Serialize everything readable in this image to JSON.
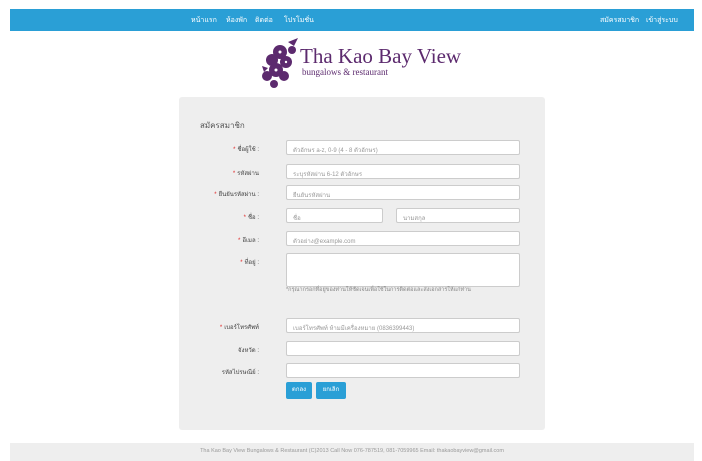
{
  "nav": {
    "left_items": [
      {
        "label": "หน้าแรก"
      },
      {
        "label": "ห้องพัก"
      },
      {
        "label": "ติดต่อ"
      },
      {
        "label": "โปรโมชั่น"
      }
    ],
    "right_items": [
      {
        "label": "สมัครสมาชิก"
      },
      {
        "label": "เข้าสู่ระบบ"
      }
    ]
  },
  "logo": {
    "title": "Tha Kao Bay View",
    "subtitle": "bungalows & restaurant"
  },
  "form": {
    "title": "สมัครสมาชิก",
    "fields": {
      "username": {
        "label": "ชื่อผู้ใช้ :",
        "placeholder": "ตัวอักษร a-z, 0-9 (4 - 8 ตัวอักษร)"
      },
      "password": {
        "label": "รหัสผ่าน",
        "placeholder": "ระบุรหัสผ่าน 6-12 ตัวอักษร"
      },
      "confirm_password": {
        "label": "ยืนยันรหัสผ่าน :",
        "placeholder": "ยืนยันรหัสผ่าน"
      },
      "name": {
        "label": "ชื่อ :",
        "first_placeholder": "ชื่อ",
        "last_placeholder": "นามสกุล"
      },
      "email": {
        "label": "อีเมล :",
        "placeholder": "ตัวอย่าง@example.com"
      },
      "address": {
        "label": "ที่อยู่ :",
        "placeholder": ""
      },
      "address_help": "*กรุณากรอกที่อยู่ของท่านให้ชัดเจนเพื่อใช้ในการติดต่อและส่งเอกสารให้แก่ท่าน",
      "phone": {
        "label": "เบอร์โทรศัพท์",
        "placeholder": "เบอร์โทรศัพท์ ห้ามมีเครื่องหมาย (0836399443)"
      },
      "province": {
        "label": "จังหวัด :",
        "placeholder": ""
      },
      "zipcode": {
        "label": "รหัสไปรษณีย์ :",
        "placeholder": ""
      }
    },
    "buttons": {
      "submit": "ตกลง",
      "reset": "ยกเลิก"
    }
  },
  "footer": {
    "text": "Tha Kao Bay View Bungalows & Restaurant (C)2013 Call Now 076-787519, 081-7059965 Email: thakaobayview@gmail.com"
  },
  "colors": {
    "nav_bg": "#2a9fd6",
    "panel_bg": "#eeeeee",
    "button": "#2a9fd6",
    "required": "#e02020",
    "logo": "#5c2a6e"
  }
}
